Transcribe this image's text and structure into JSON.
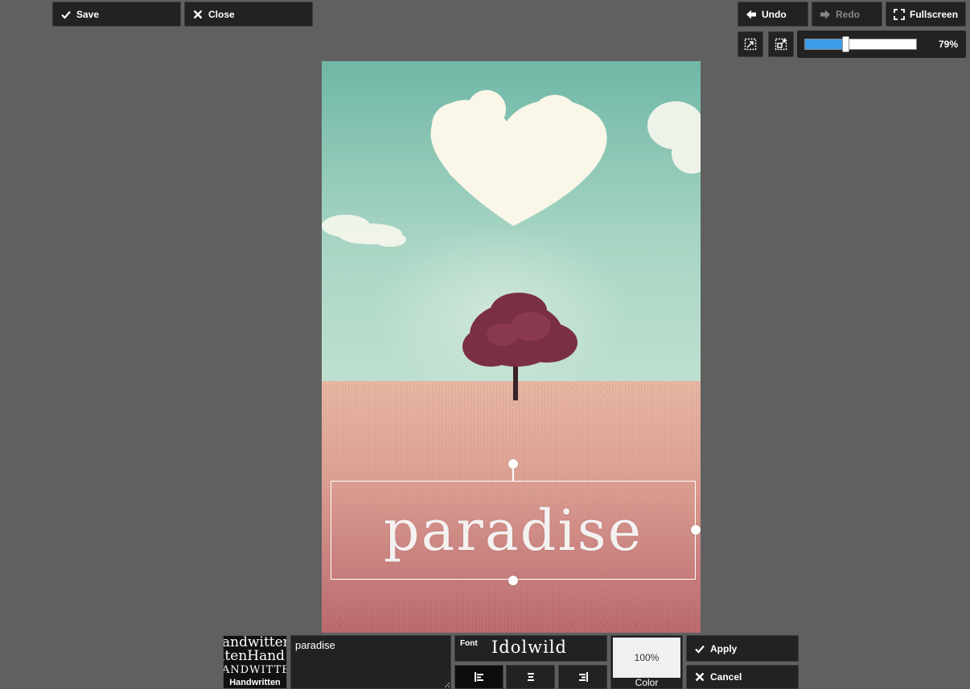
{
  "toolbar": {
    "save_label": "Save",
    "close_label": "Close",
    "undo_label": "Undo",
    "redo_label": "Redo",
    "fullscreen_label": "Fullscreen"
  },
  "zoom": {
    "percent": 79,
    "label": "79%"
  },
  "canvas": {
    "overlay_text": "paradise"
  },
  "text_tool": {
    "font_category": {
      "samples": [
        "andwitten",
        "itenHand",
        "ANDWITTEN"
      ],
      "label": "Handwritten"
    },
    "text_value": "paradise",
    "font": {
      "label": "Font",
      "value": "Idolwild"
    },
    "alignment": {
      "options": [
        "left",
        "center",
        "right"
      ],
      "selected": "left"
    },
    "color": {
      "opacity_label": "100%",
      "label": "Color",
      "swatch": "#f0f0f0"
    },
    "apply_label": "Apply",
    "cancel_label": "Cancel"
  },
  "colors": {
    "background": "#606060",
    "button_bg": "#222222",
    "accent": "#3d9be9"
  }
}
